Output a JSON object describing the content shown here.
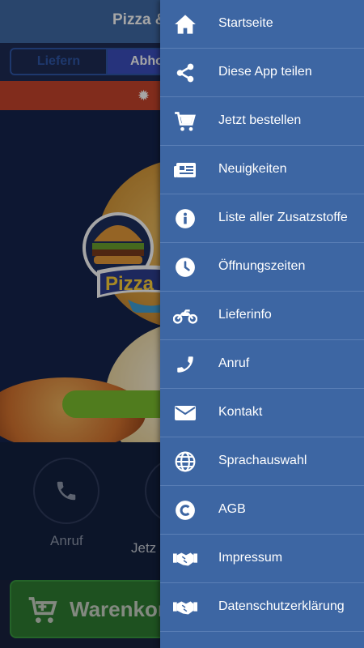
{
  "app": {
    "title": "Pizza &",
    "tabs": {
      "deliver": "Liefern",
      "pickup": "Abho"
    },
    "promo_icon": "gear-icon",
    "actions": {
      "call": "Anruf",
      "order": "Jetz"
    },
    "cart_button": "Warenkorb"
  },
  "drawer": {
    "items": [
      {
        "label": "Startseite",
        "icon": "home-icon"
      },
      {
        "label": "Diese App teilen",
        "icon": "share-icon"
      },
      {
        "label": "Jetzt bestellen",
        "icon": "cart-icon"
      },
      {
        "label": "Neuigkeiten",
        "icon": "newspaper-icon"
      },
      {
        "label": "Liste aller Zusatzstoffe",
        "icon": "info-icon"
      },
      {
        "label": "Öffnungszeiten",
        "icon": "clock-icon"
      },
      {
        "label": "Lieferinfo",
        "icon": "motorcycle-icon"
      },
      {
        "label": "Anruf",
        "icon": "phone-icon"
      },
      {
        "label": "Kontakt",
        "icon": "envelope-icon"
      },
      {
        "label": "Sprachauswahl",
        "icon": "globe-icon"
      },
      {
        "label": "AGB",
        "icon": "copyright-icon"
      },
      {
        "label": "Impressum",
        "icon": "handshake-icon"
      },
      {
        "label": "Datenschutzerklärung",
        "icon": "handshake-icon"
      }
    ]
  },
  "colors": {
    "drawer_bg": "#3d66a3",
    "promo": "#c7442c",
    "cart_green": "#2e7d32",
    "pickup_tab": "#3b4fbf"
  }
}
